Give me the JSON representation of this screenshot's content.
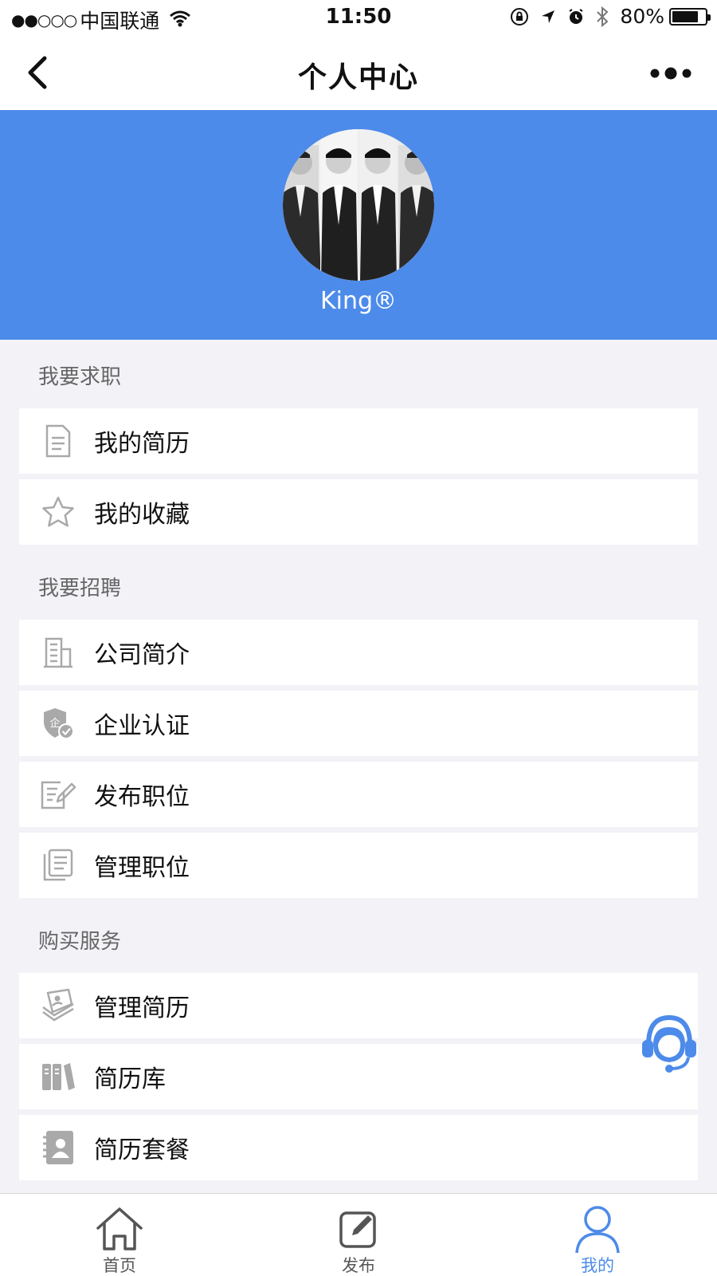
{
  "status_bar": {
    "signal": "●●○○○",
    "carrier": "中国联通",
    "time": "11:50",
    "battery_text": "80%",
    "battery_level": 0.8
  },
  "nav": {
    "title": "个人中心"
  },
  "profile": {
    "username": "King®",
    "header_color": "#4d8bea"
  },
  "sections": {
    "job_seek": "我要求职",
    "recruit": "我要招聘",
    "buy": "购买服务"
  },
  "menu": {
    "resume": "我的简历",
    "favorites": "我的收藏",
    "company_intro": "公司简介",
    "company_verify": "企业认证",
    "post_job": "发布职位",
    "manage_jobs": "管理职位",
    "manage_resumes": "管理简历",
    "resume_library": "简历库",
    "resume_package": "简历套餐"
  },
  "tabs": {
    "home": "首页",
    "publish": "发布",
    "mine": "我的"
  },
  "colors": {
    "accent": "#4d8bea",
    "icon_gray": "#a9a9a9"
  }
}
